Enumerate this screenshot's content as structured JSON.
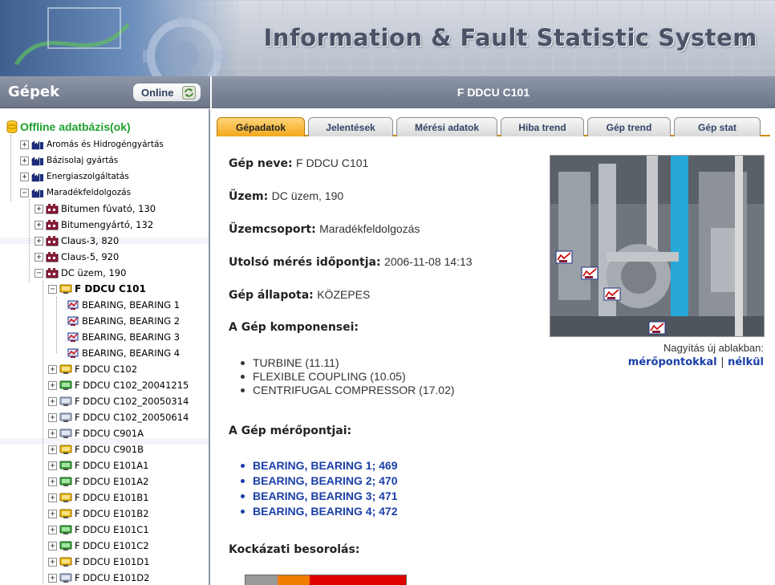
{
  "app": {
    "title": "Information & Fault Statistic System"
  },
  "sidebar": {
    "title": "Gépek",
    "online_button": "Online",
    "root_label": "Offline adatbázis(ok)",
    "items": [
      "Aromás és Hidrogéngyártás",
      "Bázisolaj gyártás",
      "Energiaszolgáltatás",
      "Maradékfeldolgozás",
      "Bitumen fúvató, 130",
      "Bitumengyártó, 132",
      "Claus-3, 820",
      "Claus-5, 920",
      "DC üzem, 190",
      "F DDCU C101",
      "BEARING, BEARING 1",
      "BEARING, BEARING 2",
      "BEARING, BEARING 3",
      "BEARING, BEARING 4",
      "F DDCU C102",
      "F DDCU C102_20041215",
      "F DDCU C102_20050314",
      "F DDCU C102_20050614",
      "F DDCU C901A",
      "F DDCU C901B",
      "F DDCU E101A1",
      "F DDCU E101A2",
      "F DDCU E101B1",
      "F DDCU E101B2",
      "F DDCU E101C1",
      "F DDCU E101C2",
      "F DDCU E101D1",
      "F DDCU E101D2"
    ]
  },
  "machine": {
    "header_title": "F DDCU C101",
    "tabs": [
      "Gépadatok",
      "Jelentések",
      "Mérési adatok",
      "Hiba trend",
      "Gép trend",
      "Gép stat"
    ],
    "active_tab": "Gépadatok",
    "name_label": "Gép neve:",
    "name_value": "F DDCU C101",
    "plant_label": "Üzem:",
    "plant_value": "DC üzem, 190",
    "group_label": "Üzemcsoport:",
    "group_value": "Maradékfeldolgozás",
    "last_measure_label": "Utolsó mérés időpontja:",
    "last_measure_value": "2006-11-08 14:13",
    "state_label": "Gép állapota:",
    "state_value": "KÖZEPES",
    "components_title": "A Gép komponensei:",
    "components": [
      "TURBINE (11.11)",
      "FLEXIBLE COUPLING (10.05)",
      "CENTRIFUGAL COMPRESSOR (17.02)"
    ],
    "points_title": "A Gép mérőpontjai:",
    "points": [
      "BEARING, BEARING 1; 469",
      "BEARING, BEARING 2; 470",
      "BEARING, BEARING 3; 471",
      "BEARING, BEARING 4; 472"
    ],
    "zoom_text": "Nagyítás új ablakban:",
    "zoom_with": "mérőpontokkal",
    "zoom_separator": "|",
    "zoom_without": "nélkül",
    "risk_title": "Kockázati besorolás:",
    "risk_colors": [
      "#9a9a9a",
      "#f07c00",
      "#e00000",
      "#e00000",
      "#e00000"
    ]
  },
  "colors": {
    "accent": "#f3a81c",
    "header": "#7e889a",
    "link": "#1a3fa8",
    "root_green": "#1ea02e"
  }
}
